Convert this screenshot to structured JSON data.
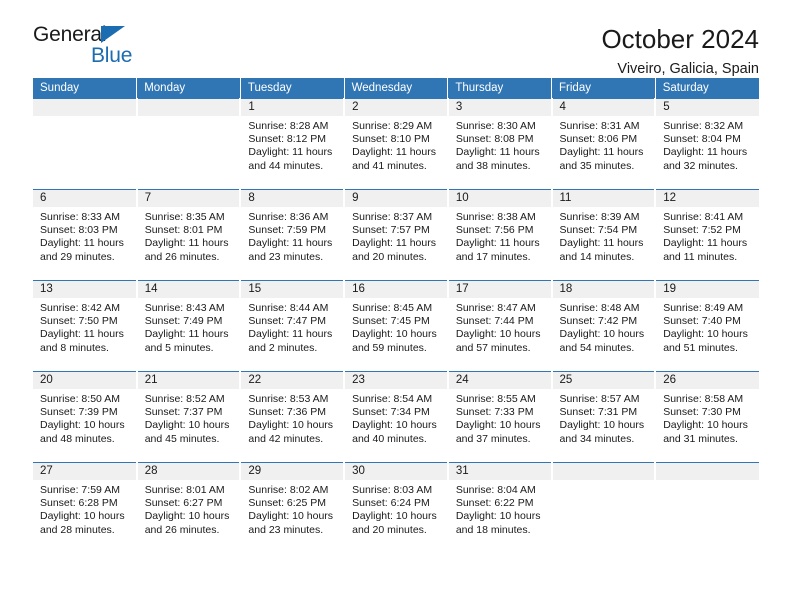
{
  "logo": {
    "word_top": "General",
    "word_bottom": "Blue",
    "triangle_icon": "triangle-icon",
    "brand_color": "#1b6cb0"
  },
  "header": {
    "title": "October 2024",
    "subtitle": "Viveiro, Galicia, Spain"
  },
  "colors": {
    "header_blue": "#3075b4",
    "daynum_band": "#f0f0f0",
    "text": "#1a1a1a"
  },
  "calendar": {
    "weekday_headers": [
      "Sunday",
      "Monday",
      "Tuesday",
      "Wednesday",
      "Thursday",
      "Friday",
      "Saturday"
    ],
    "labels": {
      "sunrise": "Sunrise:",
      "sunset": "Sunset:",
      "daylight": "Daylight:"
    },
    "weeks": [
      [
        {
          "day": "",
          "empty": true
        },
        {
          "day": "",
          "empty": true
        },
        {
          "day": "1",
          "sunrise": "Sunrise: 8:28 AM",
          "sunset": "Sunset: 8:12 PM",
          "daylight": "Daylight: 11 hours and 44 minutes."
        },
        {
          "day": "2",
          "sunrise": "Sunrise: 8:29 AM",
          "sunset": "Sunset: 8:10 PM",
          "daylight": "Daylight: 11 hours and 41 minutes."
        },
        {
          "day": "3",
          "sunrise": "Sunrise: 8:30 AM",
          "sunset": "Sunset: 8:08 PM",
          "daylight": "Daylight: 11 hours and 38 minutes."
        },
        {
          "day": "4",
          "sunrise": "Sunrise: 8:31 AM",
          "sunset": "Sunset: 8:06 PM",
          "daylight": "Daylight: 11 hours and 35 minutes."
        },
        {
          "day": "5",
          "sunrise": "Sunrise: 8:32 AM",
          "sunset": "Sunset: 8:04 PM",
          "daylight": "Daylight: 11 hours and 32 minutes."
        }
      ],
      [
        {
          "day": "6",
          "sunrise": "Sunrise: 8:33 AM",
          "sunset": "Sunset: 8:03 PM",
          "daylight": "Daylight: 11 hours and 29 minutes."
        },
        {
          "day": "7",
          "sunrise": "Sunrise: 8:35 AM",
          "sunset": "Sunset: 8:01 PM",
          "daylight": "Daylight: 11 hours and 26 minutes."
        },
        {
          "day": "8",
          "sunrise": "Sunrise: 8:36 AM",
          "sunset": "Sunset: 7:59 PM",
          "daylight": "Daylight: 11 hours and 23 minutes."
        },
        {
          "day": "9",
          "sunrise": "Sunrise: 8:37 AM",
          "sunset": "Sunset: 7:57 PM",
          "daylight": "Daylight: 11 hours and 20 minutes."
        },
        {
          "day": "10",
          "sunrise": "Sunrise: 8:38 AM",
          "sunset": "Sunset: 7:56 PM",
          "daylight": "Daylight: 11 hours and 17 minutes."
        },
        {
          "day": "11",
          "sunrise": "Sunrise: 8:39 AM",
          "sunset": "Sunset: 7:54 PM",
          "daylight": "Daylight: 11 hours and 14 minutes."
        },
        {
          "day": "12",
          "sunrise": "Sunrise: 8:41 AM",
          "sunset": "Sunset: 7:52 PM",
          "daylight": "Daylight: 11 hours and 11 minutes."
        }
      ],
      [
        {
          "day": "13",
          "sunrise": "Sunrise: 8:42 AM",
          "sunset": "Sunset: 7:50 PM",
          "daylight": "Daylight: 11 hours and 8 minutes."
        },
        {
          "day": "14",
          "sunrise": "Sunrise: 8:43 AM",
          "sunset": "Sunset: 7:49 PM",
          "daylight": "Daylight: 11 hours and 5 minutes."
        },
        {
          "day": "15",
          "sunrise": "Sunrise: 8:44 AM",
          "sunset": "Sunset: 7:47 PM",
          "daylight": "Daylight: 11 hours and 2 minutes."
        },
        {
          "day": "16",
          "sunrise": "Sunrise: 8:45 AM",
          "sunset": "Sunset: 7:45 PM",
          "daylight": "Daylight: 10 hours and 59 minutes."
        },
        {
          "day": "17",
          "sunrise": "Sunrise: 8:47 AM",
          "sunset": "Sunset: 7:44 PM",
          "daylight": "Daylight: 10 hours and 57 minutes."
        },
        {
          "day": "18",
          "sunrise": "Sunrise: 8:48 AM",
          "sunset": "Sunset: 7:42 PM",
          "daylight": "Daylight: 10 hours and 54 minutes."
        },
        {
          "day": "19",
          "sunrise": "Sunrise: 8:49 AM",
          "sunset": "Sunset: 7:40 PM",
          "daylight": "Daylight: 10 hours and 51 minutes."
        }
      ],
      [
        {
          "day": "20",
          "sunrise": "Sunrise: 8:50 AM",
          "sunset": "Sunset: 7:39 PM",
          "daylight": "Daylight: 10 hours and 48 minutes."
        },
        {
          "day": "21",
          "sunrise": "Sunrise: 8:52 AM",
          "sunset": "Sunset: 7:37 PM",
          "daylight": "Daylight: 10 hours and 45 minutes."
        },
        {
          "day": "22",
          "sunrise": "Sunrise: 8:53 AM",
          "sunset": "Sunset: 7:36 PM",
          "daylight": "Daylight: 10 hours and 42 minutes."
        },
        {
          "day": "23",
          "sunrise": "Sunrise: 8:54 AM",
          "sunset": "Sunset: 7:34 PM",
          "daylight": "Daylight: 10 hours and 40 minutes."
        },
        {
          "day": "24",
          "sunrise": "Sunrise: 8:55 AM",
          "sunset": "Sunset: 7:33 PM",
          "daylight": "Daylight: 10 hours and 37 minutes."
        },
        {
          "day": "25",
          "sunrise": "Sunrise: 8:57 AM",
          "sunset": "Sunset: 7:31 PM",
          "daylight": "Daylight: 10 hours and 34 minutes."
        },
        {
          "day": "26",
          "sunrise": "Sunrise: 8:58 AM",
          "sunset": "Sunset: 7:30 PM",
          "daylight": "Daylight: 10 hours and 31 minutes."
        }
      ],
      [
        {
          "day": "27",
          "sunrise": "Sunrise: 7:59 AM",
          "sunset": "Sunset: 6:28 PM",
          "daylight": "Daylight: 10 hours and 28 minutes."
        },
        {
          "day": "28",
          "sunrise": "Sunrise: 8:01 AM",
          "sunset": "Sunset: 6:27 PM",
          "daylight": "Daylight: 10 hours and 26 minutes."
        },
        {
          "day": "29",
          "sunrise": "Sunrise: 8:02 AM",
          "sunset": "Sunset: 6:25 PM",
          "daylight": "Daylight: 10 hours and 23 minutes."
        },
        {
          "day": "30",
          "sunrise": "Sunrise: 8:03 AM",
          "sunset": "Sunset: 6:24 PM",
          "daylight": "Daylight: 10 hours and 20 minutes."
        },
        {
          "day": "31",
          "sunrise": "Sunrise: 8:04 AM",
          "sunset": "Sunset: 6:22 PM",
          "daylight": "Daylight: 10 hours and 18 minutes."
        },
        {
          "day": "",
          "empty": true
        },
        {
          "day": "",
          "empty": true
        }
      ]
    ]
  }
}
